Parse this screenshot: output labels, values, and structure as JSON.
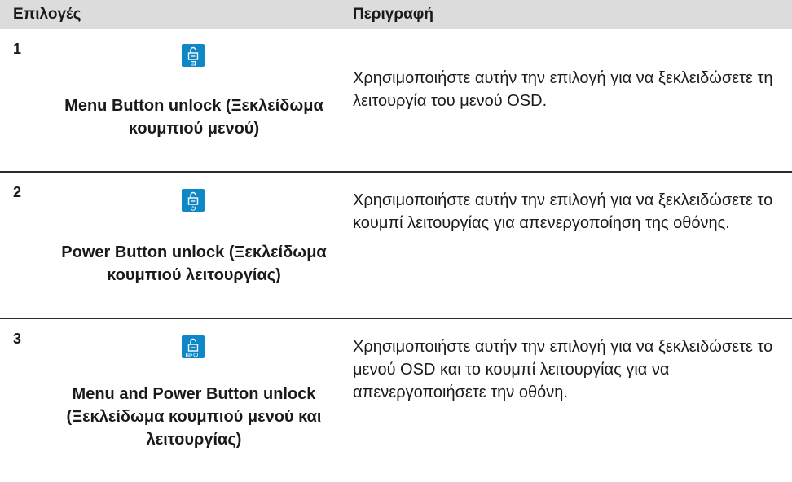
{
  "header": {
    "col1": "Επιλογές",
    "col2": "Περιγραφή"
  },
  "rows": [
    {
      "num": "1",
      "icon": "menu-unlock-icon",
      "label": "Menu Button unlock (Ξεκλείδωμα κουμπιού μενού)",
      "description": "Χρησιμοποιήστε αυτήν την επιλογή για να ξεκλειδώσετε τη λειτουργία του μενού OSD."
    },
    {
      "num": "2",
      "icon": "power-unlock-icon",
      "label": "Power Button unlock (Ξεκλείδωμα κουμπιού λειτουργίας)",
      "description": "Χρησιμοποιήστε αυτήν την επιλογή για να ξεκλειδώσετε το κουμπί λειτουργίας για απενεργοποίηση της οθόνης."
    },
    {
      "num": "3",
      "icon": "menu-power-unlock-icon",
      "label": "Menu and Power Button unlock (Ξεκλείδωμα κουμπιού μενού και λειτουργίας)",
      "description": "Χρησιμοποιήστε αυτήν την επιλογή για να ξεκλειδώσετε το μενού OSD και το κουμπί λειτουργίας για να απενεργοποιήσετε την οθόνη."
    }
  ],
  "colors": {
    "header_bg": "#dcdcdc",
    "icon_bg": "#0d87c5",
    "separator": "#2b2b2b"
  }
}
